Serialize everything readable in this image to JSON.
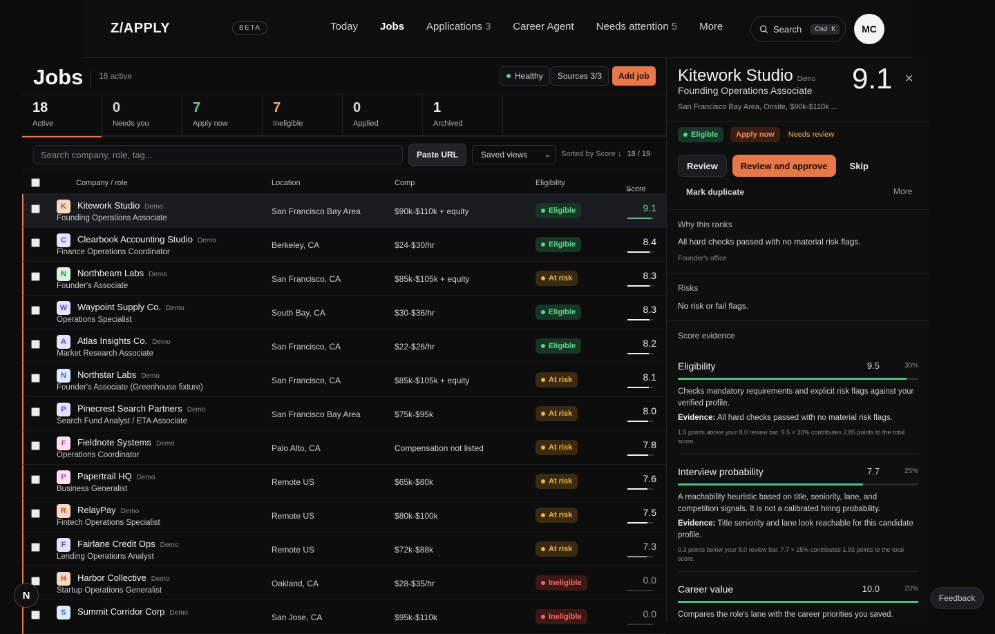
{
  "app": {
    "logo": "Z/APPLY",
    "badge": "BETA"
  },
  "nav": {
    "items": [
      {
        "label": "Today",
        "count": ""
      },
      {
        "label": "Jobs",
        "count": ""
      },
      {
        "label": "Applications",
        "count": "3"
      },
      {
        "label": "Career Agent",
        "count": ""
      },
      {
        "label": "Needs attention",
        "count": "5"
      },
      {
        "label": "More",
        "count": ""
      }
    ],
    "search_label": "Search",
    "search_kbd": "Cmd  K",
    "avatar": "MC"
  },
  "header": {
    "title": "Jobs",
    "active_text": "18 active",
    "healthy_label": "Healthy",
    "sources_label": "Sources 3/3",
    "add_job_label": "Add job"
  },
  "stats": [
    {
      "n": "18",
      "label": "Active",
      "color": "#f0f0f0"
    },
    {
      "n": "0",
      "label": "Needs you",
      "color": "#d8d8d8"
    },
    {
      "n": "7",
      "label": "Apply now",
      "color": "#5fd68e"
    },
    {
      "n": "7",
      "label": "Ineligible",
      "color": "#f0b44a"
    },
    {
      "n": "0",
      "label": "Applied",
      "color": "#d8d8d8"
    },
    {
      "n": "1",
      "label": "Archived",
      "color": "#f0f0f0"
    }
  ],
  "filters": {
    "search_placeholder": "Search company, role, tag...",
    "paste_label": "Paste URL",
    "saved_label": "Saved views",
    "sorted_label": "Sorted by Score ↓",
    "result_count": "18 / 19"
  },
  "table": {
    "headers": {
      "company": "Company / role",
      "location": "Location",
      "comp": "Comp",
      "eligibility": "Eligibility",
      "score": "Score"
    },
    "demo_tag": "Demo",
    "rows": [
      {
        "logo": "K",
        "logo_bg": "#f7d6c4",
        "logo_fg": "#b8532a",
        "company": "Kitework Studio",
        "role": "Founding Operations Associate",
        "location": "San Francisco Bay Area",
        "comp": "$90k-$110k + equity",
        "elig": "Eligible",
        "elig_kind": "e",
        "score": "9.1",
        "score_color": "#5fd68e",
        "bar": 0.91,
        "bar_color": "#4fbf7e"
      },
      {
        "logo": "C",
        "logo_bg": "#e6e2ff",
        "logo_fg": "#5b4ccf",
        "company": "Clearbook Accounting Studio",
        "role": "Finance Operations Coordinator",
        "location": "Berkeley, CA",
        "comp": "$24-$30/hr",
        "elig": "Eligible",
        "elig_kind": "e",
        "score": "8.4",
        "score_color": "#f0f0f0",
        "bar": 0.84,
        "bar_color": "#f2f2f2"
      },
      {
        "logo": "N",
        "logo_bg": "#d9f2e2",
        "logo_fg": "#2f8a55",
        "company": "Northbeam Labs",
        "role": "Founder's Associate",
        "location": "San Francisco, CA",
        "comp": "$85k-$105k + equity",
        "elig": "At risk",
        "elig_kind": "r",
        "score": "8.3",
        "score_color": "#f0f0f0",
        "bar": 0.83,
        "bar_color": "#f2f2f2"
      },
      {
        "logo": "W",
        "logo_bg": "#e6e2ff",
        "logo_fg": "#5b4ccf",
        "company": "Waypoint Supply Co.",
        "role": "Operations Specialist",
        "location": "South Bay, CA",
        "comp": "$30-$36/hr",
        "elig": "Eligible",
        "elig_kind": "e",
        "score": "8.3",
        "score_color": "#f0f0f0",
        "bar": 0.83,
        "bar_color": "#f2f2f2"
      },
      {
        "logo": "A",
        "logo_bg": "#e6e2ff",
        "logo_fg": "#5b4ccf",
        "company": "Atlas Insights Co.",
        "role": "Market Research Associate",
        "location": "San Francisco, CA",
        "comp": "$22-$26/hr",
        "elig": "Eligible",
        "elig_kind": "e",
        "score": "8.2",
        "score_color": "#f0f0f0",
        "bar": 0.82,
        "bar_color": "#f2f2f2"
      },
      {
        "logo": "N",
        "logo_bg": "#dfeaff",
        "logo_fg": "#3b6bd4",
        "company": "Northstar Labs",
        "role": "Founder's Associate (Greenhouse fixture)",
        "location": "San Francisco, CA",
        "comp": "$85k-$105k + equity",
        "elig": "At risk",
        "elig_kind": "r",
        "score": "8.1",
        "score_color": "#f0f0f0",
        "bar": 0.81,
        "bar_color": "#f2f2f2"
      },
      {
        "logo": "P",
        "logo_bg": "#e6e2ff",
        "logo_fg": "#5b4ccf",
        "company": "Pinecrest Search Partners",
        "role": "Search Fund Analyst / ETA Associate",
        "location": "San Francisco Bay Area",
        "comp": "$75k-$95k",
        "elig": "At risk",
        "elig_kind": "r",
        "score": "8.0",
        "score_color": "#f0f0f0",
        "bar": 0.8,
        "bar_color": "#f2f2f2"
      },
      {
        "logo": "F",
        "logo_bg": "#fbe1ef",
        "logo_fg": "#b24a86",
        "company": "Fieldnote Systems",
        "role": "Operations Coordinator",
        "location": "Palo Alto, CA",
        "comp": "Compensation not listed",
        "elig": "At risk",
        "elig_kind": "r",
        "score": "7.8",
        "score_color": "#f0f0f0",
        "bar": 0.78,
        "bar_color": "#f2f2f2"
      },
      {
        "logo": "P",
        "logo_bg": "#fbe1ef",
        "logo_fg": "#b24a86",
        "company": "Papertrail HQ",
        "role": "Business Generalist",
        "location": "Remote US",
        "comp": "$65k-$80k",
        "elig": "At risk",
        "elig_kind": "r",
        "score": "7.6",
        "score_color": "#f0f0f0",
        "bar": 0.76,
        "bar_color": "#f2f2f2"
      },
      {
        "logo": "R",
        "logo_bg": "#f7d6c4",
        "logo_fg": "#b8532a",
        "company": "RelayPay",
        "role": "Fintech Operations Specialist",
        "location": "Remote US",
        "comp": "$80k-$100k",
        "elig": "At risk",
        "elig_kind": "r",
        "score": "7.5",
        "score_color": "#f0f0f0",
        "bar": 0.75,
        "bar_color": "#f2f2f2"
      },
      {
        "logo": "F",
        "logo_bg": "#e6e2ff",
        "logo_fg": "#5b4ccf",
        "company": "Fairlane Credit Ops",
        "role": "Lending Operations Analyst",
        "location": "Remote US",
        "comp": "$72k-$88k",
        "elig": "At risk",
        "elig_kind": "r",
        "score": "7.3",
        "score_color": "#bdbdbd",
        "bar": 0.73,
        "bar_color": "#9a9a9a"
      },
      {
        "logo": "H",
        "logo_bg": "#f7d6c4",
        "logo_fg": "#b8532a",
        "company": "Harbor Collective",
        "role": "Startup Operations Generalist",
        "location": "Oakland, CA",
        "comp": "$28-$35/hr",
        "elig": "Ineligible",
        "elig_kind": "i",
        "score": "0.0",
        "score_color": "#9a9a9a",
        "bar": 0.0,
        "bar_color": "#555"
      },
      {
        "logo": "S",
        "logo_bg": "#dfeaff",
        "logo_fg": "#3b6bd4",
        "company": "Summit Corridor Corp",
        "role": "",
        "location": "San Jose, CA",
        "comp": "$95k-$110k",
        "elig": "Ineligible",
        "elig_kind": "i",
        "score": "0.0",
        "score_color": "#9a9a9a",
        "bar": 0.0,
        "bar_color": "#555"
      }
    ]
  },
  "panel": {
    "company": "Kitework Studio",
    "demo": "Demo",
    "role": "Founding Operations Associate",
    "score": "9.1",
    "meta": "San Francisco Bay Area, Onsite, $90k-$110k ...",
    "chips": {
      "eligible": "Eligible",
      "apply_now": "Apply now",
      "needs_review": "Needs review"
    },
    "actions": {
      "review": "Review",
      "approve": "Review and approve",
      "skip": "Skip",
      "duplicate": "Mark duplicate",
      "more": "More"
    },
    "why_title": "Why this ranks",
    "why_text": "All hard checks passed with no material risk flags.",
    "why_note": "Founder's office",
    "risks_title": "Risks",
    "risks_text": "No risk or fail flags.",
    "evidence_title": "Score evidence",
    "evidence": [
      {
        "name": "Eligibility",
        "value": "9.5",
        "weight": "30%",
        "fill": 0.95,
        "text": "Checks mandatory requirements and explicit risk flags against your verified profile.",
        "ev_label": "Evidence:",
        "ev_text": "All hard checks passed with no material risk flags.",
        "note": "1.5 points above your 8.0 review bar. 9.5 × 30% contributes 2.85 points to the total score."
      },
      {
        "name": "Interview probability",
        "value": "7.7",
        "weight": "25%",
        "fill": 0.77,
        "text": "A reachability heuristic based on title, seniority, lane, and competition signals. It is not a calibrated hiring probability.",
        "ev_label": "Evidence:",
        "ev_text": "Title seniority and lane look reachable for this candidate profile.",
        "note": "0.3 points below your 8.0 review bar. 7.7 × 25% contributes 1.93 points to the total score."
      },
      {
        "name": "Career value",
        "value": "10.0",
        "weight": "20%",
        "fill": 1.0,
        "text": "Compares the role's lane with the career priorities you saved.",
        "ev_label": "",
        "ev_text": "",
        "note": ""
      }
    ]
  },
  "feedback_label": "Feedback",
  "bubble_label": "N"
}
